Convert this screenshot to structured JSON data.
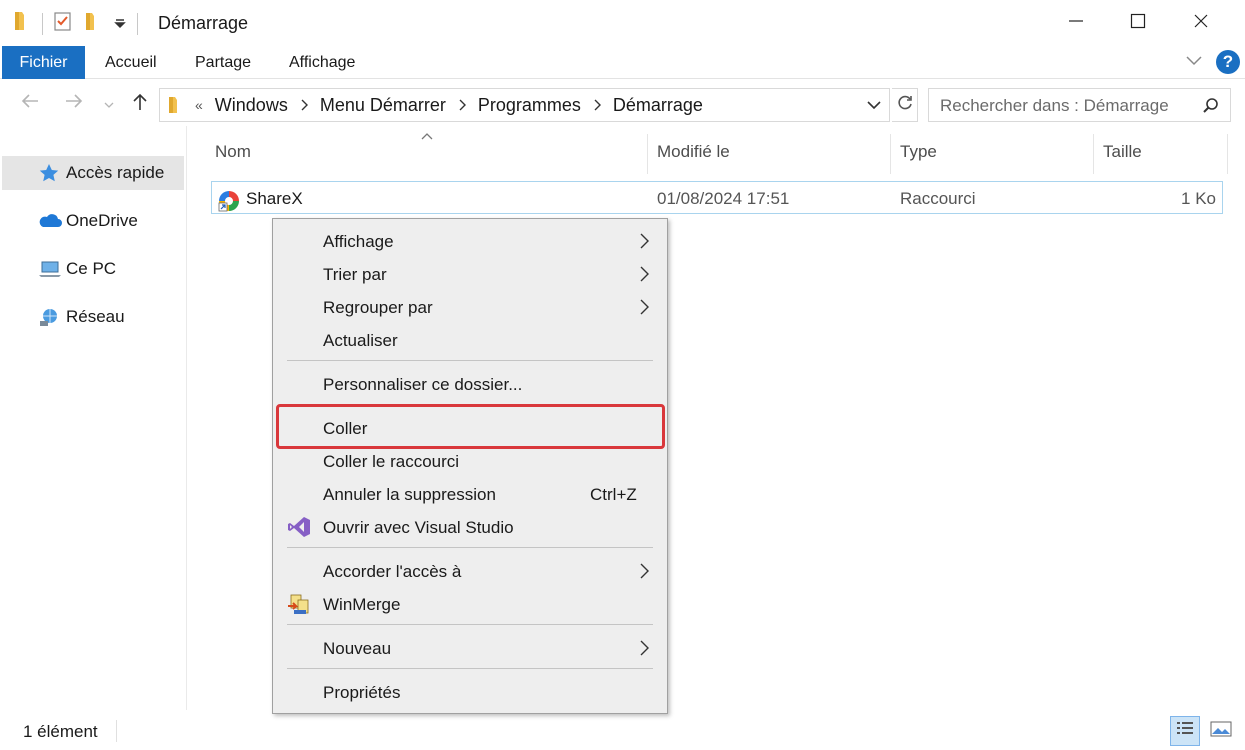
{
  "window": {
    "title": "Démarrage"
  },
  "ribbon": {
    "tabs": [
      "Fichier",
      "Accueil",
      "Partage",
      "Affichage"
    ]
  },
  "address": {
    "overflow": "«",
    "crumbs": [
      "Windows",
      "Menu Démarrer",
      "Programmes",
      "Démarrage"
    ]
  },
  "search": {
    "placeholder": "Rechercher dans : Démarrage"
  },
  "nav": {
    "items": [
      {
        "label": "Accès rapide",
        "icon": "star-icon",
        "selected": true
      },
      {
        "label": "OneDrive",
        "icon": "cloud-icon",
        "selected": false
      },
      {
        "label": "Ce PC",
        "icon": "computer-icon",
        "selected": false
      },
      {
        "label": "Réseau",
        "icon": "network-icon",
        "selected": false
      }
    ]
  },
  "columns": {
    "name": "Nom",
    "modified": "Modifié le",
    "type": "Type",
    "size": "Taille"
  },
  "files": [
    {
      "name": "ShareX",
      "modified": "01/08/2024 17:51",
      "type": "Raccourci",
      "size": "1 Ko"
    }
  ],
  "context_menu": {
    "items": [
      {
        "label": "Affichage",
        "submenu": true
      },
      {
        "label": "Trier par",
        "submenu": true
      },
      {
        "label": "Regrouper par",
        "submenu": true
      },
      {
        "label": "Actualiser"
      },
      {
        "label": "Personnaliser ce dossier..."
      },
      {
        "label": "Coller",
        "highlighted": true
      },
      {
        "label": "Coller le raccourci"
      },
      {
        "label": "Annuler la suppression",
        "shortcut": "Ctrl+Z"
      },
      {
        "label": "Ouvrir avec Visual Studio",
        "icon": "visual-studio-icon"
      },
      {
        "label": "Accorder l'accès à",
        "submenu": true
      },
      {
        "label": "WinMerge",
        "icon": "winmerge-icon"
      },
      {
        "label": "Nouveau",
        "submenu": true
      },
      {
        "label": "Propriétés"
      }
    ]
  },
  "status": {
    "count": "1 élément"
  },
  "colors": {
    "accent": "#1a6fc2",
    "highlight_border": "#d9373b",
    "menu_bg": "#eeeeee",
    "selected_nav": "#e5e5e5"
  }
}
